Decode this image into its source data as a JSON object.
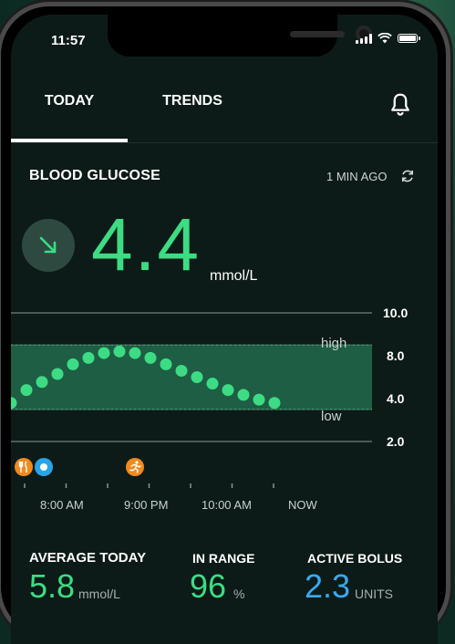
{
  "status_bar": {
    "time": "11:57"
  },
  "tabs": [
    {
      "label": "TODAY",
      "active": true
    },
    {
      "label": "TRENDS",
      "active": false
    }
  ],
  "header": {
    "title": "BLOOD GLUCOSE",
    "updated": "1 MIN AGO"
  },
  "reading": {
    "value": "4.4",
    "unit": "mmol/L",
    "trend": "falling"
  },
  "chart_data": {
    "type": "scatter",
    "y_ticks": [
      "10.0",
      "8.0",
      "4.0",
      "2.0"
    ],
    "ylim": [
      2.0,
      10.0
    ],
    "target_range": [
      4.0,
      8.0
    ],
    "band_labels": {
      "high": "high",
      "low": "low"
    },
    "points": [
      4.4,
      5.2,
      5.7,
      6.2,
      6.8,
      7.2,
      7.5,
      7.6,
      7.5,
      7.2,
      6.8,
      6.4,
      6.0,
      5.6,
      5.2,
      4.9,
      4.6,
      4.4
    ],
    "x_labels": [
      "8:00 AM",
      "9:00 PM",
      "10:00 AM",
      "NOW"
    ],
    "events": [
      {
        "type": "meal",
        "icon": "fork-knife-icon",
        "color": "#ef8a1e"
      },
      {
        "type": "insulin",
        "icon": "dot-icon",
        "color": "#2aa3e8"
      },
      {
        "type": "exercise",
        "icon": "runner-icon",
        "color": "#ef8a1e"
      }
    ]
  },
  "stats": [
    {
      "label": "AVERAGE TODAY",
      "value": "5.8",
      "unit": "mmol/L",
      "color": "#3ddc84"
    },
    {
      "label": "IN RANGE",
      "value": "96",
      "unit": "%",
      "color": "#3ddc84"
    },
    {
      "label": "ACTIVE BOLUS",
      "value": "2.3",
      "unit": "UNITS",
      "color": "#3aa8f0"
    }
  ],
  "colors": {
    "accent": "#3ddc84",
    "range_band": "#1d5e44",
    "bolus": "#3aa8f0"
  }
}
